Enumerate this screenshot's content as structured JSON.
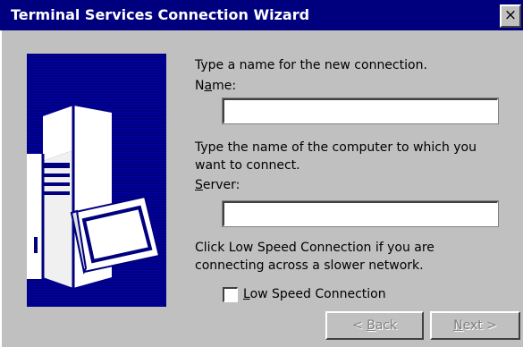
{
  "window": {
    "title": "Terminal Services Connection Wizard",
    "close_label": "×"
  },
  "connection_name": {
    "prompt": "Type a name for the new connection.",
    "label_pre": "N",
    "label_accel": "a",
    "label_post": "me:",
    "value": ""
  },
  "server": {
    "prompt_line1": "Type the name of the computer to which you",
    "prompt_line2": "want to connect.",
    "label_accel": "S",
    "label_post": "erver:",
    "value": ""
  },
  "low_speed": {
    "hint_line1": "Click Low Speed Connection if you are",
    "hint_line2": "connecting across a slower network.",
    "label_accel": "L",
    "label_post": "ow Speed Connection",
    "checked": false
  },
  "buttons": {
    "back_pre": "< ",
    "back_accel": "B",
    "back_post": "ack",
    "next_accel": "N",
    "next_post": "ext >"
  },
  "colors": {
    "titlebar": "#00007f",
    "face": "#c0c0c0",
    "art": "#00007f"
  }
}
